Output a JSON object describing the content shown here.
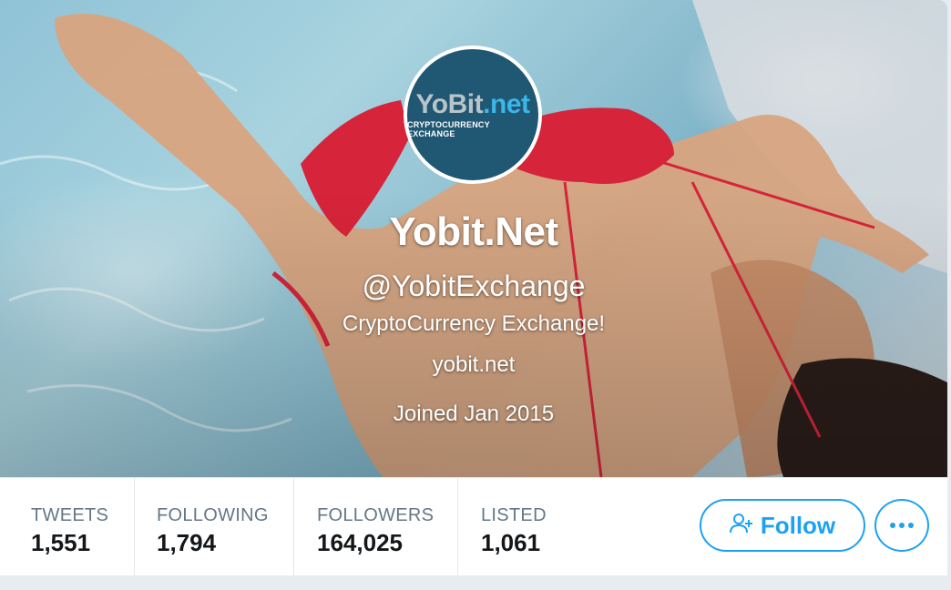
{
  "profile": {
    "avatar_logo_brand": "YoBit",
    "avatar_logo_tld": ".net",
    "avatar_logo_tagline": "CRYPTOCURRENCY EXCHANGE",
    "name": "Yobit.Net",
    "handle": "@YobitExchange",
    "bio": "CryptoCurrency Exchange!",
    "url": "yobit.net",
    "joined": "Joined Jan 2015"
  },
  "stats": {
    "tweets": {
      "label": "TWEETS",
      "value": "1,551"
    },
    "following": {
      "label": "FOLLOWING",
      "value": "1,794"
    },
    "followers": {
      "label": "FOLLOWERS",
      "value": "164,025"
    },
    "listed": {
      "label": "LISTED",
      "value": "1,061"
    }
  },
  "actions": {
    "follow_label": "Follow",
    "follow_icon": "add-user-icon",
    "more_icon": "more-dots-icon"
  },
  "colors": {
    "accent": "#1da1f2",
    "avatar_bg": "#205773",
    "text_primary": "#14171a",
    "text_secondary": "#657786"
  }
}
